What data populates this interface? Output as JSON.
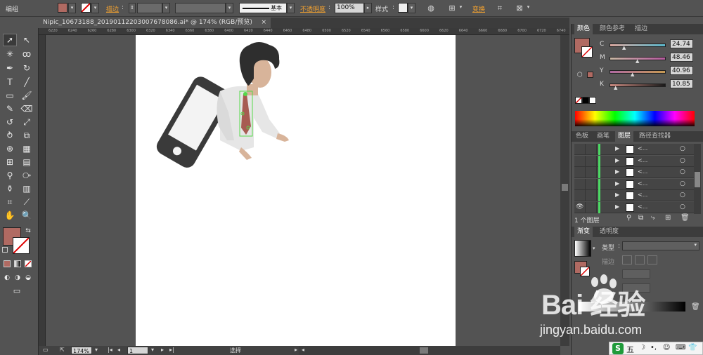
{
  "toolbar": {
    "group_label": "编组",
    "stroke_label": "描边",
    "stroke_style": "基本",
    "opacity_label": "不透明度",
    "opacity_value": "100%",
    "style_label": "样式",
    "transform_label": "变换",
    "fill_color": "#b06a62"
  },
  "document": {
    "tab_title": "Nipic_10673188_20190112203007678086.ai* @ 174% (RGB/预览)",
    "close_symbol": "×"
  },
  "ruler": {
    "ticks": [
      "6220",
      "6240",
      "6260",
      "6280",
      "6300",
      "6320",
      "6340",
      "6360",
      "6380",
      "6400",
      "6420",
      "6440",
      "6460",
      "6480",
      "6500",
      "6520",
      "6540",
      "6560",
      "6580",
      "6600",
      "6620",
      "6640",
      "6660",
      "6680",
      "6700",
      "6720",
      "6740"
    ]
  },
  "color_panel": {
    "tabs": [
      "颜色",
      "颜色参考",
      "描边"
    ],
    "channels": [
      {
        "name": "C",
        "value": "24.74"
      },
      {
        "name": "M",
        "value": "48.46"
      },
      {
        "name": "Y",
        "value": "40.96"
      },
      {
        "name": "K",
        "value": "10.85"
      }
    ],
    "current_color": "#b06a62"
  },
  "layers_panel": {
    "tabs": [
      "色板",
      "画笔",
      "图层",
      "路径查找器"
    ],
    "rows": [
      {
        "name": "<...",
        "visible": false
      },
      {
        "name": "<...",
        "visible": false
      },
      {
        "name": "<...",
        "visible": false
      },
      {
        "name": "<...",
        "visible": false
      },
      {
        "name": "<...",
        "visible": false
      },
      {
        "name": "<...",
        "visible": true
      }
    ],
    "footer_label": "1 个图层"
  },
  "gradient_panel": {
    "tabs": [
      "渐变",
      "透明度"
    ],
    "type_label": "类型",
    "stroke_label": "描边"
  },
  "status": {
    "zoom": "174%",
    "page": "1",
    "mode": "选择"
  },
  "watermark": {
    "brand": "Bai 经验",
    "url": "jingyan.baidu.com"
  },
  "ime": {
    "label": "五"
  }
}
